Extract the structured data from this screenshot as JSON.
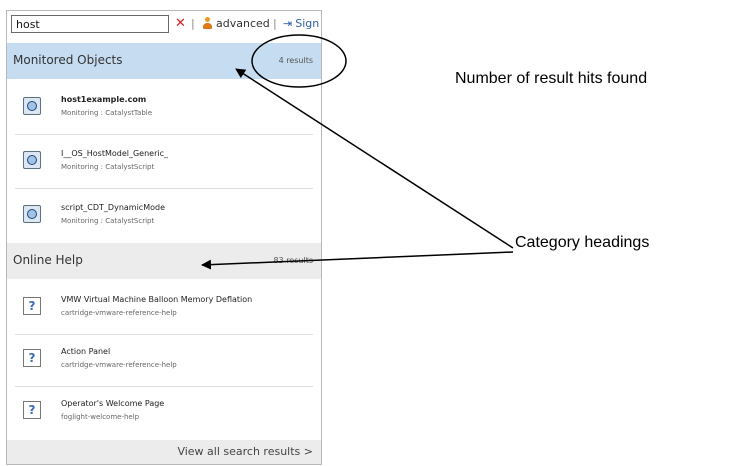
{
  "search": {
    "value": "host",
    "clear_glyph": "✕",
    "separator": "|"
  },
  "toolbar": {
    "advanced_label": "advanced",
    "signout_label": "Sign O"
  },
  "categories": [
    {
      "title": "Monitored Objects",
      "count": "4 results"
    },
    {
      "title": "Online Help",
      "count": "83 results"
    }
  ],
  "monitored_items": [
    {
      "name": "host1example.com",
      "sub": "Monitoring : CatalystTable",
      "icon": "monitored-object-icon"
    },
    {
      "name": "I__OS_HostModel_Generic_",
      "sub": "Monitoring : CatalystScript",
      "icon": "monitored-object-icon"
    },
    {
      "name": "script_CDT_DynamicMode",
      "sub": "Monitoring : CatalystScript",
      "icon": "monitored-object-icon"
    }
  ],
  "help_items": [
    {
      "name": "VMW Virtual Machine Balloon Memory Deflation",
      "sub": "cartridge-vmware-reference-help",
      "icon": "help-page-icon",
      "glyph": "?"
    },
    {
      "name": "Action Panel",
      "sub": "cartridge-vmware-reference-help",
      "icon": "help-page-icon",
      "glyph": "?"
    },
    {
      "name": "Operator's Welcome Page",
      "sub": "foglight-welcome-help",
      "icon": "help-page-icon",
      "glyph": "?"
    }
  ],
  "footer": {
    "view_all": "View all search results >"
  },
  "annotations": {
    "result_hits": "Number of result hits found",
    "category_headings": "Category headings"
  },
  "colors": {
    "header_blue": "#c5dcf1",
    "header_gray": "#ececec",
    "clear_red": "#d42020",
    "link_blue": "#2b5ea8"
  }
}
